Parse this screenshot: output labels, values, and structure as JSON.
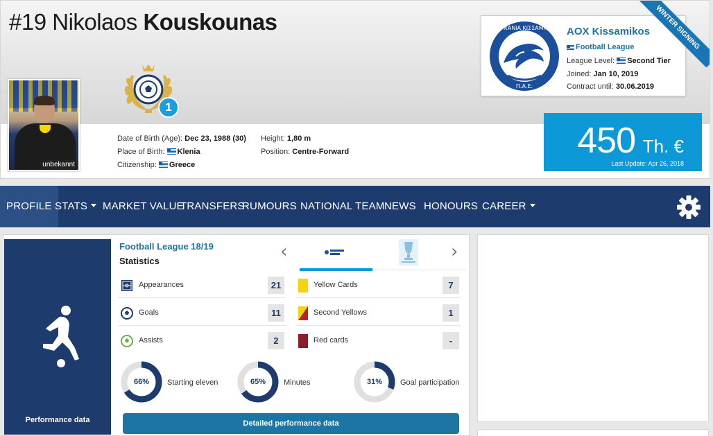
{
  "player": {
    "number": "#19",
    "first_name": "Nikolaos",
    "last_name": "Kouskounas",
    "photo_caption": "unbekannt",
    "award_count": "1"
  },
  "info": {
    "dob_label": "Date of Birth (Age):",
    "dob_value": "Dec 23, 1988 (30)",
    "pob_label": "Place of Birth:",
    "pob_value": "Klenia",
    "citizenship_label": "Citizenship:",
    "citizenship_value": "Greece",
    "height_label": "Height:",
    "height_value": "1,80 m",
    "position_label": "Position:",
    "position_value": "Centre-Forward"
  },
  "club": {
    "name": "AOX Kissamikos",
    "league": "Football League",
    "league_level_label": "League Level:",
    "league_level_value": "Second Tier",
    "joined_label": "Joined:",
    "joined_value": "Jan 10, 2019",
    "contract_label": "Contract until:",
    "contract_value": "30.06.2019",
    "ribbon": "WINTER SIGNING",
    "logo_text": "Α.Ο ΧΑΝΙΑ ΚΙΣΣΑΜΙΚΟΣ",
    "logo_sub": "Π.Α.Ε."
  },
  "market_value": {
    "value": "450",
    "unit": "Th. €",
    "updated": "Last Update: Apr 26, 2018"
  },
  "nav": {
    "items": [
      "PROFILE",
      "STATS",
      "MARKET VALUE",
      "TRANSFERS",
      "RUMOURS",
      "NATIONAL TEAM",
      "NEWS",
      "HONOURS",
      "CAREER"
    ]
  },
  "stats": {
    "competition": "Football League 18/19",
    "title": "Statistics",
    "side_label": "Performance data",
    "left": [
      {
        "label": "Appearances",
        "value": "21"
      },
      {
        "label": "Goals",
        "value": "11"
      },
      {
        "label": "Assists",
        "value": "2"
      }
    ],
    "right": [
      {
        "label": "Yellow Cards",
        "value": "7"
      },
      {
        "label": "Second Yellows",
        "value": "1"
      },
      {
        "label": "Red cards",
        "value": "-"
      }
    ],
    "donuts": [
      {
        "pct_label": "66%",
        "pct": 66,
        "label": "Starting eleven"
      },
      {
        "pct_label": "65%",
        "pct": 65,
        "label": "Minutes"
      },
      {
        "pct_label": "31%",
        "pct": 31,
        "label": "Goal participation"
      }
    ],
    "detail_button": "Detailed performance data",
    "colors": {
      "accent": "#1d3c6d",
      "track": "#e0e0e0",
      "yellow": "#f7d40a",
      "red": "#8e1b2a",
      "blue": "#0d99d8"
    }
  }
}
